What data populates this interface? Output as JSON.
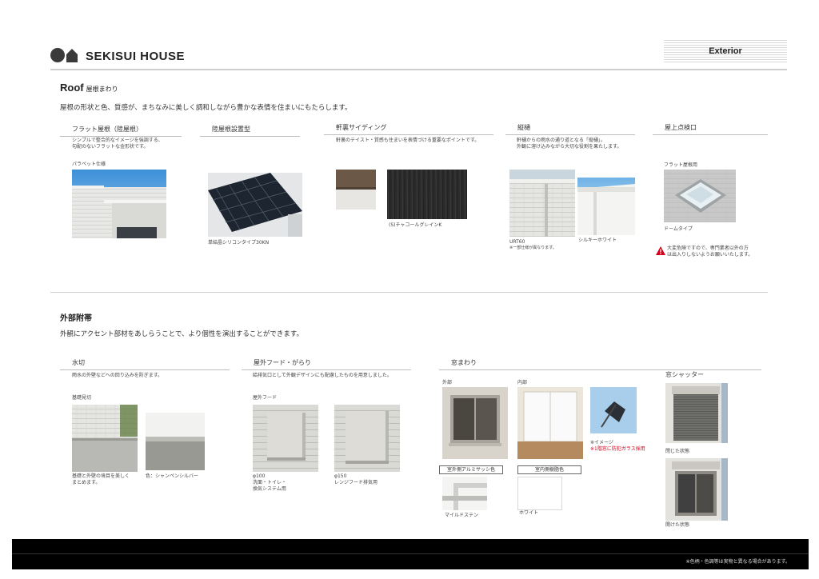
{
  "header": {
    "brand": "SEKISUI HOUSE",
    "section_label": "Exterior"
  },
  "roof": {
    "title": "Roof",
    "title_jp": "屋根まわり",
    "lead": "屋根の形状と色、質感が、まちなみに美しく調和しながら豊かな表情を住まいにもたらします。",
    "flat_roof": {
      "heading": "フラット屋根（陸屋根）",
      "description_1": "シンプルで整合的なイメージを強調する、",
      "description_2": "勾配のないフラットな金形状です。",
      "sub_label": "パラペット仕様"
    },
    "solar": {
      "heading": "陸屋根設置型",
      "caption": "単結晶シリコンタイプ30KN"
    },
    "soffit": {
      "heading": "軒裏サイディング",
      "description": "軒裏のテイスト・質感も住まいを表情づける重要なポイントです。",
      "caption": "(S)チャコールグレインK"
    },
    "gutter": {
      "heading": "縦樋",
      "description_1": "軒樋からの雨水の通り道となる「縦樋」。",
      "description_2": "外観に溶け込みながら大切な役割を果たします。",
      "caption_model": "URT60",
      "caption_note": "※一部仕様が異なります。",
      "caption_color": "シルキーホワイト"
    },
    "hatch": {
      "heading": "屋上点検口",
      "sub_label": "フラット屋根用",
      "caption": "ドームタイプ",
      "warning_1": "大変危険ですので、専門業者以外の方",
      "warning_2": "は出入りしないようお願いいたします。"
    }
  },
  "accessories": {
    "title": "外部附帯",
    "lead": "外観にアクセント部材をあしらうことで、より個性を演出することができます。",
    "flashing": {
      "heading": "水切",
      "description": "雨水の外壁などへの回り込みを防ぎます。",
      "sub_label": "基礎見切",
      "caption_1a": "基礎と外壁の境目を美しく",
      "caption_1b": "まとめます。",
      "caption_2": "色：シャンペンシルバー"
    },
    "hood": {
      "heading": "屋外フード・がらり",
      "description": "給排気口として外観デザインにも配慮したものを用意しました。",
      "sub_label": "屋外フード",
      "caption_1a": "φ100",
      "caption_1b": "洗面・トイレ・",
      "caption_1c": "換気システム用",
      "caption_2a": "φ150",
      "caption_2b": "レンジフード排気用"
    },
    "window": {
      "heading": "窓まわり",
      "outside_label": "外部",
      "inside_label": "内部",
      "image_note": "※イメージ",
      "glass_note": "※1階窓に防犯ガラス採用",
      "sash_label": "室外側アルミサッシ色",
      "resin_label": "室内側樹脂色",
      "sash_color": "マイルドステン",
      "resin_color": "ホワイト"
    },
    "shutter": {
      "heading": "窓シャッター",
      "closed_label": "閉じた状態",
      "open_label": "開けた状態"
    }
  },
  "footer": {
    "note": "※色柄・色調等は実物と異なる場合があります。"
  },
  "colors": {
    "warning_red": "#d6001c",
    "footer_band": "#000000",
    "sky_blue": "#5fa6e0"
  }
}
